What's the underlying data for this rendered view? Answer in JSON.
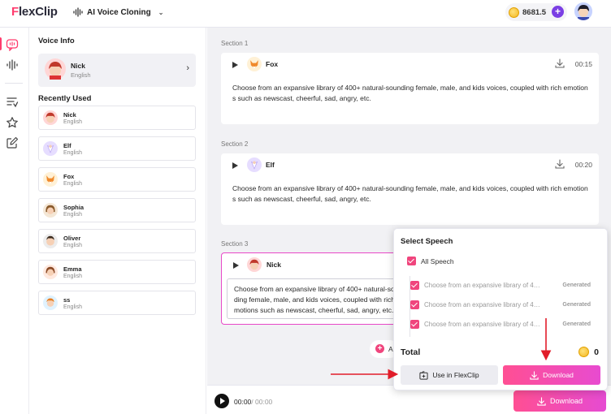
{
  "header": {
    "logo_f": "F",
    "logo_rest": "lexClip",
    "project_name": "AI Voice Cloning",
    "credits": "8681.5"
  },
  "colors": {
    "accent_pink": "#ff3c6e",
    "accent_purple": "#7b3fe4",
    "active_border": "#e849c8",
    "download_gradient_start": "#ff4f93",
    "download_gradient_end": "#e64bd2",
    "annotation_arrow": "#e11d2a"
  },
  "voice_panel": {
    "voice_info_title": "Voice Info",
    "current_voice": {
      "name": "Nick",
      "language": "English",
      "avatar": "nick-avatar"
    },
    "recent_title": "Recently Used",
    "recent": [
      {
        "name": "Nick",
        "language": "English",
        "avatar": "nick-avatar"
      },
      {
        "name": "Elf",
        "language": "English",
        "avatar": "elf-avatar"
      },
      {
        "name": "Fox",
        "language": "English",
        "avatar": "fox-avatar"
      },
      {
        "name": "Sophia",
        "language": "English",
        "avatar": "sophia-avatar"
      },
      {
        "name": "Oliver",
        "language": "English",
        "avatar": "oliver-avatar"
      },
      {
        "name": "Emma",
        "language": "English",
        "avatar": "emma-avatar"
      },
      {
        "name": "ss",
        "language": "English",
        "avatar": "ss-avatar"
      }
    ]
  },
  "sections": [
    {
      "label": "Section 1",
      "voice": "Fox",
      "duration": "00:15",
      "text": "Choose from an expansive library of 400+ natural-sounding female, male, and kids voices, coupled with rich emotions such as newscast, cheerful, sad, angry, etc."
    },
    {
      "label": "Section 2",
      "voice": "Elf",
      "duration": "00:20",
      "text": "Choose from an expansive library of 400+ natural-sounding female, male, and kids voices, coupled with rich emotions such as newscast, cheerful, sad, angry, etc."
    },
    {
      "label": "Section 3",
      "voice": "Nick",
      "duration": "",
      "text": "Choose from an expansive library of 400+ natural-sounding female, male, and kids voices, coupled with rich emotions such as newscast, cheerful, sad, angry, etc."
    }
  ],
  "add_button_label": "A",
  "player": {
    "current": "00:00",
    "separator": "/ ",
    "total": "00:00",
    "download_label": "Download"
  },
  "popup": {
    "title": "Select Speech",
    "all_label": "All Speech",
    "items": [
      {
        "text": "Choose from an expansive library of 40...",
        "status": "Generated"
      },
      {
        "text": "Choose from an expansive library of 40...",
        "status": "Generated"
      },
      {
        "text": "Choose from an expansive library of 40...",
        "status": "Generated"
      }
    ],
    "total_label": "Total",
    "total_value": "0",
    "use_label": "Use in FlexClip",
    "download_label": "Download"
  }
}
